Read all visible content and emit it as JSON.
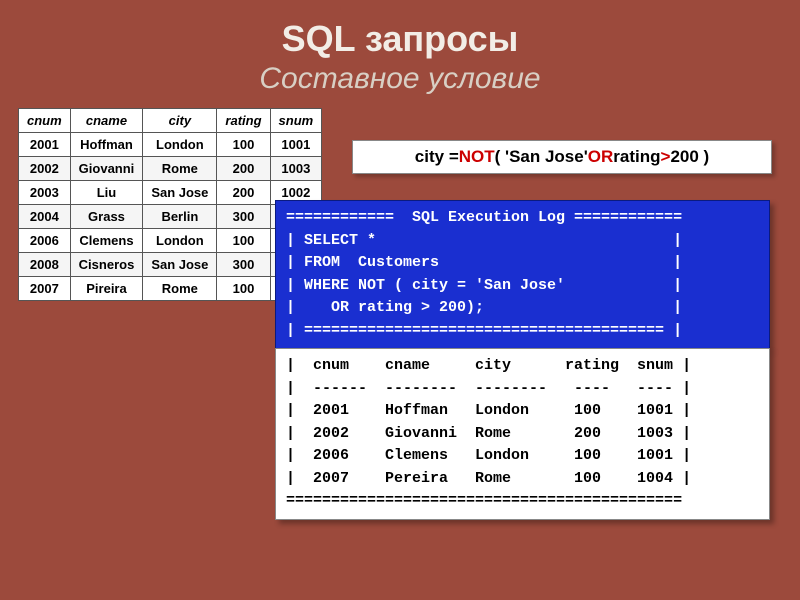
{
  "title": {
    "main": "SQL запросы",
    "sub": "Составное условие"
  },
  "table": {
    "headers": [
      "cnum",
      "cname",
      "city",
      "rating",
      "snum"
    ],
    "rows": [
      [
        "2001",
        "Hoffman",
        "London",
        "100",
        "1001"
      ],
      [
        "2002",
        "Giovanni",
        "Rome",
        "200",
        "1003"
      ],
      [
        "2003",
        "Liu",
        "San Jose",
        "200",
        "1002"
      ],
      [
        "2004",
        "Grass",
        "Berlin",
        "300",
        ""
      ],
      [
        "2006",
        "Clemens",
        "London",
        "100",
        ""
      ],
      [
        "2008",
        "Cisneros",
        "San Jose",
        "300",
        ""
      ],
      [
        "2007",
        "Pireira",
        "Rome",
        "100",
        ""
      ]
    ]
  },
  "expr": {
    "p1": "city = ",
    "not": "NOT",
    "p2": " ( 'San Jose' ",
    "or": "OR",
    "p3": " rating ",
    "gt": ">",
    "p4": " 200 )"
  },
  "log": {
    "blue": "============  SQL Execution Log ============\n| SELECT *                                 |\n| FROM  Customers                          |\n| WHERE NOT ( city = 'San Jose'            |\n|    OR rating > 200);                     |\n| ======================================== |",
    "white": "|  cnum    cname     city      rating  snum |\n|  ------  --------  --------   ----   ---- |\n|  2001    Hoffman   London     100    1001 |\n|  2002    Giovanni  Rome       200    1003 |\n|  2006    Clemens   London     100    1001 |\n|  2007    Pereira   Rome       100    1004 |\n============================================"
  }
}
